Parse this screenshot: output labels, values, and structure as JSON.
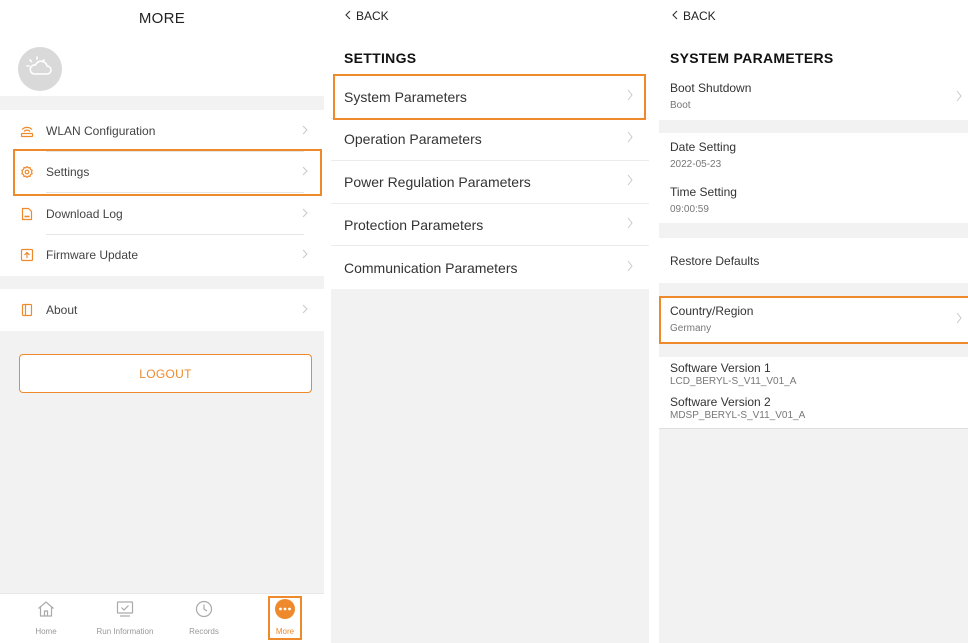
{
  "accent_color": "#ee8a2c",
  "more_page": {
    "title": "MORE",
    "avatar_icon": "cloud-sun-icon",
    "items": [
      {
        "label": "WLAN Configuration",
        "icon": "wifi-router-icon"
      },
      {
        "label": "Settings",
        "icon": "gear-icon"
      },
      {
        "label": "Download Log",
        "icon": "log-file-icon"
      },
      {
        "label": "Firmware Update",
        "icon": "upload-icon"
      }
    ],
    "about": {
      "label": "About",
      "icon": "info-panel-icon"
    },
    "logout_label": "LOGOUT",
    "bottom_nav": [
      {
        "label": "Home",
        "icon": "home-icon"
      },
      {
        "label": "Run Information",
        "icon": "monitor-check-icon"
      },
      {
        "label": "Records",
        "icon": "clock-icon"
      },
      {
        "label": "More",
        "icon": "more-dots-icon"
      }
    ]
  },
  "settings_page": {
    "back_label": "BACK",
    "title": "SETTINGS",
    "items": [
      {
        "label": "System Parameters"
      },
      {
        "label": "Operation Parameters"
      },
      {
        "label": "Power Regulation Parameters"
      },
      {
        "label": "Protection Parameters"
      },
      {
        "label": "Communication Parameters"
      }
    ]
  },
  "system_page": {
    "back_label": "BACK",
    "title": "SYSTEM PARAMETERS",
    "boot_shutdown": {
      "label": "Boot Shutdown",
      "value": "Boot"
    },
    "date_setting": {
      "label": "Date Setting",
      "value": "2022-05-23"
    },
    "time_setting": {
      "label": "Time Setting",
      "value": "09:00:59"
    },
    "restore_defaults": {
      "label": "Restore Defaults"
    },
    "country_region": {
      "label": "Country/Region",
      "value": "Germany"
    },
    "software_version_1": {
      "label": "Software Version 1",
      "value": "LCD_BERYL-S_V11_V01_A"
    },
    "software_version_2": {
      "label": "Software Version 2",
      "value": "MDSP_BERYL-S_V11_V01_A"
    }
  }
}
